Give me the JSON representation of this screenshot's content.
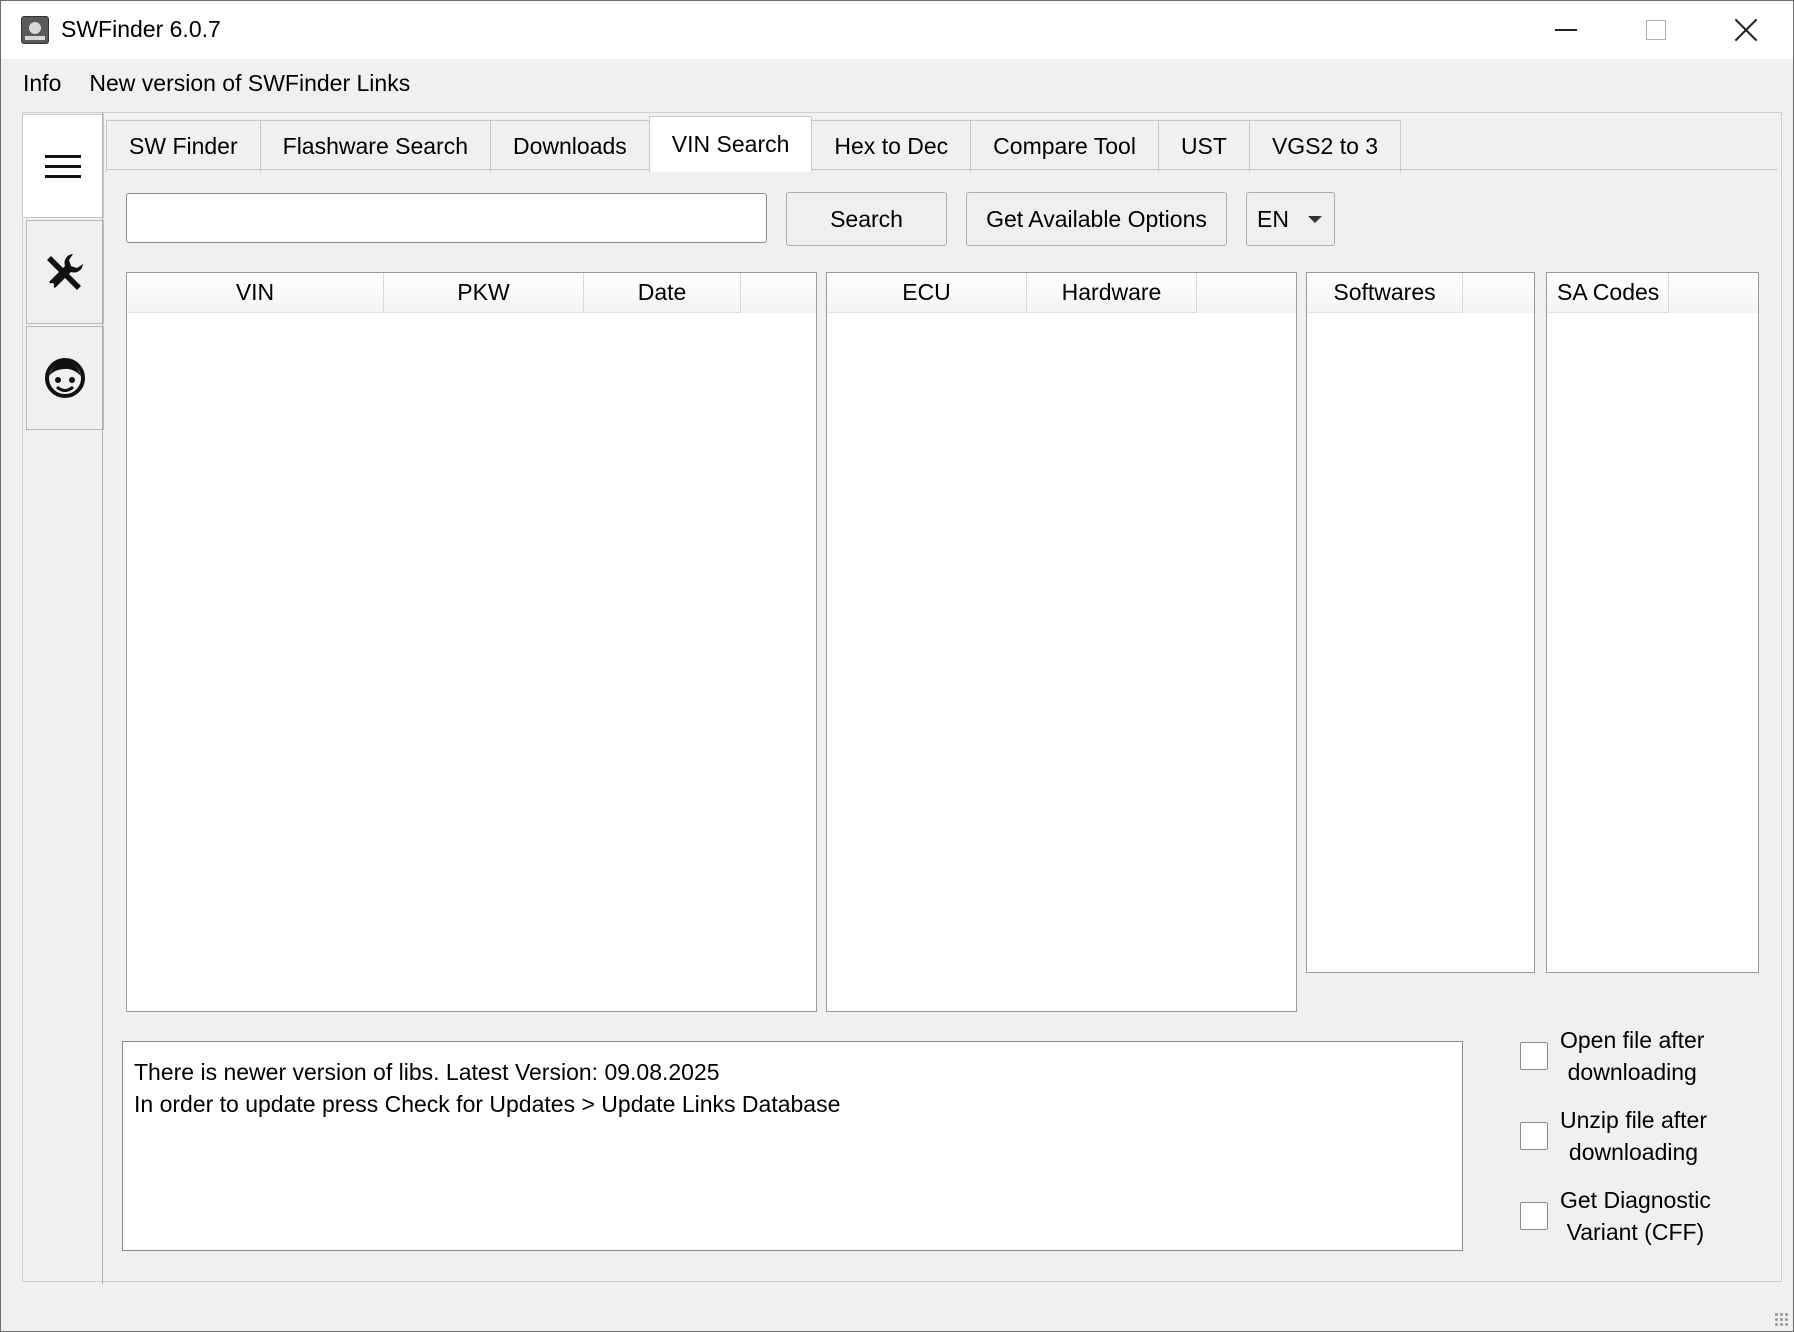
{
  "window": {
    "title": "SWFinder 6.0.7"
  },
  "menu": {
    "items": [
      "Info",
      "New version of SWFinder Links"
    ]
  },
  "tabs": [
    {
      "label": "SW Finder",
      "active": false
    },
    {
      "label": "Flashware Search",
      "active": false
    },
    {
      "label": "Downloads",
      "active": false
    },
    {
      "label": "VIN Search",
      "active": true
    },
    {
      "label": "Hex to Dec",
      "active": false
    },
    {
      "label": "Compare Tool",
      "active": false
    },
    {
      "label": "UST",
      "active": false
    },
    {
      "label": "VGS2 to 3",
      "active": false
    }
  ],
  "search": {
    "value": "",
    "button_label": "Search",
    "options_label": "Get Available Options",
    "language": "EN"
  },
  "panels": {
    "vin": {
      "columns": [
        "VIN",
        "PKW",
        "Date"
      ]
    },
    "ecu": {
      "columns": [
        "ECU",
        "Hardware"
      ]
    },
    "softwares": {
      "columns": [
        "Softwares"
      ]
    },
    "sa_codes": {
      "columns": [
        "SA Codes"
      ]
    }
  },
  "messages": {
    "line1": "There is newer version of libs. Latest Version: 09.08.2025",
    "line2": "In order to update press Check for Updates > Update Links Database"
  },
  "options": [
    {
      "line1": "Open file after",
      "line2": "downloading",
      "checked": false
    },
    {
      "line1": "Unzip file after",
      "line2": "downloading",
      "checked": false
    },
    {
      "line1": "Get Diagnostic",
      "line2": "Variant (CFF)",
      "checked": false
    }
  ],
  "icons": {
    "menu": "hamburger-icon",
    "tools": "tools-icon",
    "support": "face-icon"
  }
}
